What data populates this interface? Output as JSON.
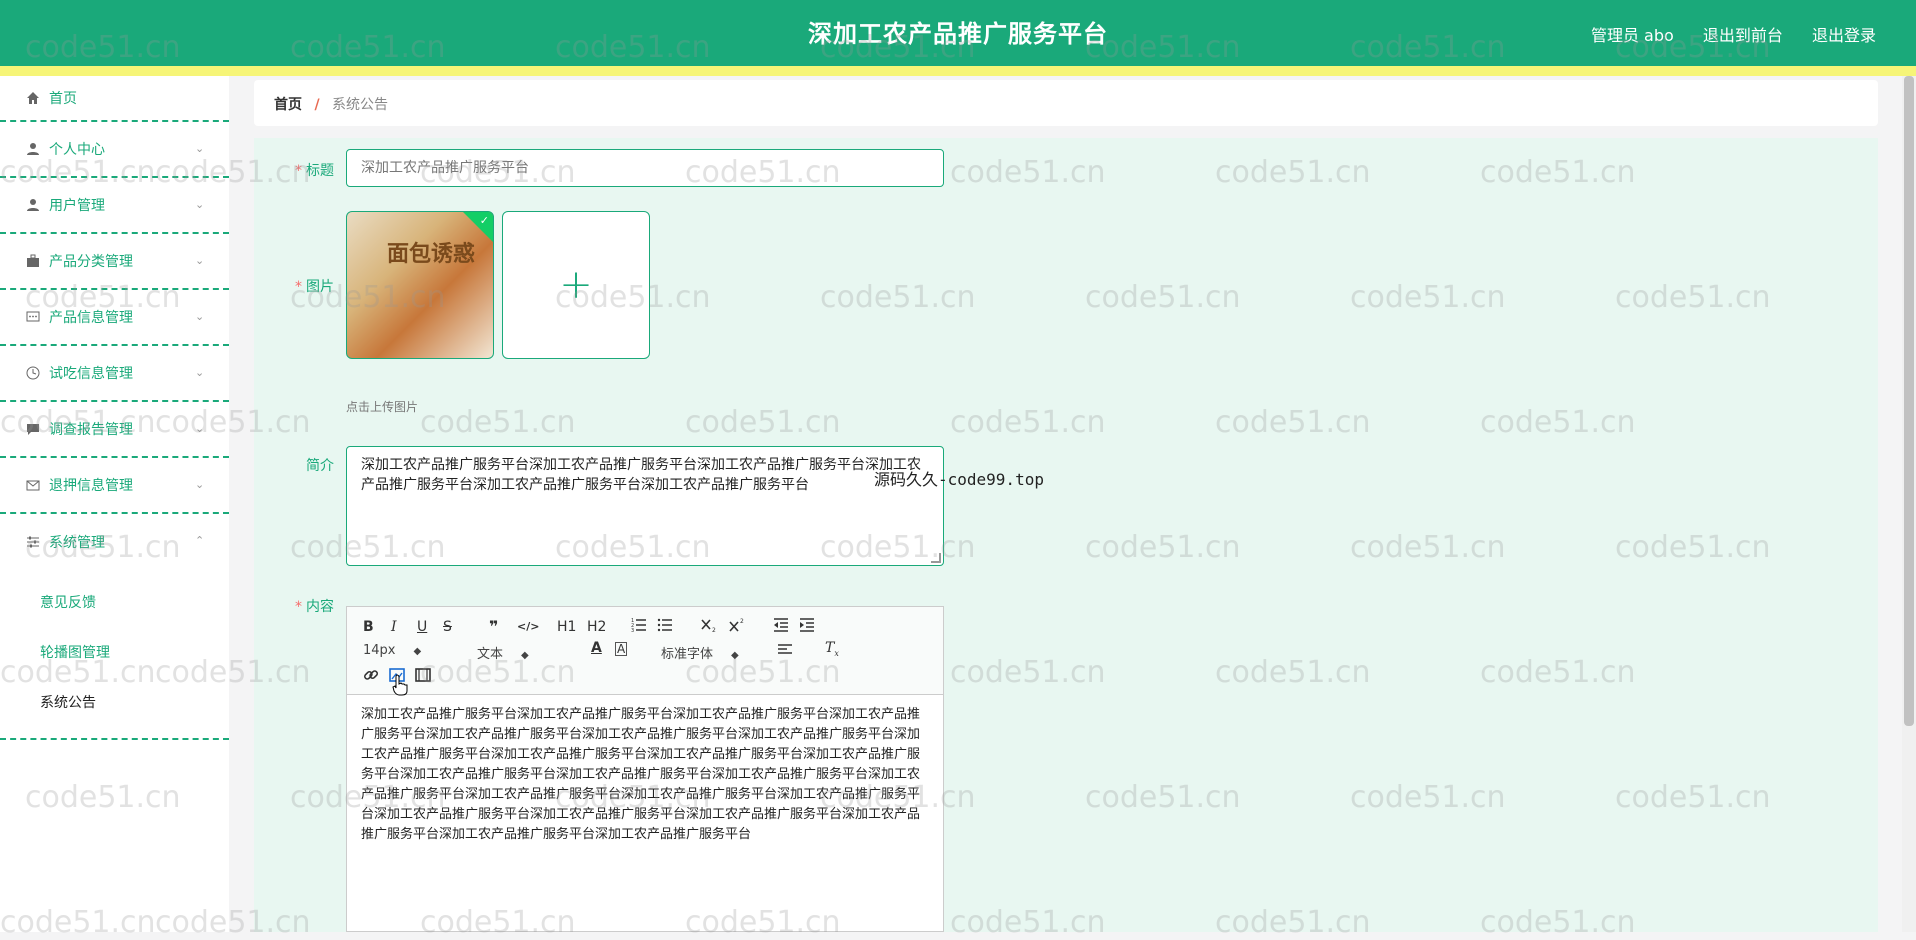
{
  "header": {
    "title": "深加工农产品推广服务平台",
    "user": "管理员 abo",
    "to_front": "退出到前台",
    "logout": "退出登录"
  },
  "sidebar": {
    "items": [
      {
        "label": "首页",
        "icon": "home-icon"
      },
      {
        "label": "个人中心",
        "icon": "user-icon"
      },
      {
        "label": "用户管理",
        "icon": "user-icon"
      },
      {
        "label": "产品分类管理",
        "icon": "briefcase-icon"
      },
      {
        "label": "产品信息管理",
        "icon": "message-icon"
      },
      {
        "label": "试吃信息管理",
        "icon": "clock-icon"
      },
      {
        "label": "调查报告管理",
        "icon": "chat-icon"
      },
      {
        "label": "退押信息管理",
        "icon": "mail-icon"
      },
      {
        "label": "系统管理",
        "icon": "settings-icon"
      }
    ],
    "sub_items": [
      "意见反馈",
      "轮播图管理",
      "系统公告"
    ]
  },
  "breadcrumb": {
    "home": "首页",
    "sep": "/",
    "current": "系统公告"
  },
  "form": {
    "title_label": "标题",
    "title_value": "深加工农产品推广服务平台",
    "image_label": "图片",
    "image_text": "面包诱惑",
    "upload_hint": "点击上传图片",
    "intro_label": "简介",
    "intro_value": "深加工农产品推广服务平台深加工农产品推广服务平台深加工农产品推广服务平台深加工农产品推广服务平台深加工农产品推广服务平台深加工农产品推广服务平台",
    "content_label": "内容",
    "content_value": "深加工农产品推广服务平台深加工农产品推广服务平台深加工农产品推广服务平台深加工农产品推广服务平台深加工农产品推广服务平台深加工农产品推广服务平台深加工农产品推广服务平台深加工农产品推广服务平台深加工农产品推广服务平台深加工农产品推广服务平台深加工农产品推广服务平台深加工农产品推广服务平台深加工农产品推广服务平台深加工农产品推广服务平台深加工农产品推广服务平台深加工农产品推广服务平台深加工农产品推广服务平台深加工农产品推广服务平台深加工农产品推广服务平台深加工农产品推广服务平台深加工农产品推广服务平台深加工农产品推广服务平台深加工农产品推广服务平台深加工农产品推广服务平台"
  },
  "editor": {
    "bold": "B",
    "italic": "I",
    "underline": "U",
    "strike": "S",
    "quote": "❞",
    "code": "</>",
    "h1": "H1",
    "h2": "H2",
    "size": "14px",
    "header": "文本",
    "font": "标准字体"
  },
  "overlay_text": "源码久久-code99.top",
  "watermark": "code51.cn",
  "colors": {
    "primary": "#1aa97a",
    "accent": "#f6f577",
    "danger": "#f56c6c"
  }
}
